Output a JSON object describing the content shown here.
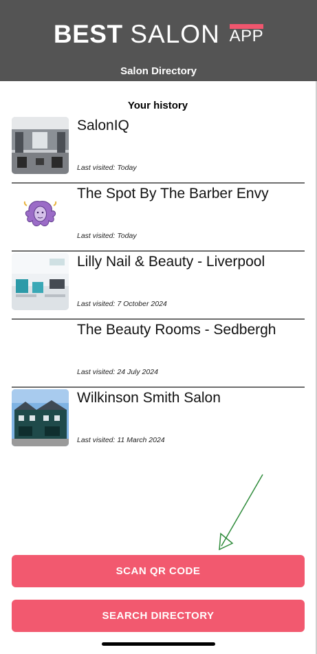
{
  "header": {
    "logo_best": "BEST",
    "logo_salon": "SALON",
    "logo_app": "APP",
    "subtitle": "Salon Directory"
  },
  "history": {
    "title": "Your history",
    "items": [
      {
        "name": "SalonIQ",
        "visited": "Last visited: Today",
        "thumb": "salon-interior-photo"
      },
      {
        "name": "The Spot By The Barber Envy",
        "visited": "Last visited: Today",
        "thumb": "medusa-logo"
      },
      {
        "name": "Lilly Nail & Beauty - Liverpool",
        "visited": "Last visited: 7 October 2024",
        "thumb": "nail-salon-photo"
      },
      {
        "name": "The Beauty Rooms - Sedbergh",
        "visited": "Last visited: 24 July 2024",
        "thumb": "none"
      },
      {
        "name": "Wilkinson Smith Salon",
        "visited": "Last visited: 11 March 2024",
        "thumb": "shopfront-photo"
      }
    ]
  },
  "buttons": {
    "scan": "SCAN QR CODE",
    "search": "SEARCH DIRECTORY"
  },
  "colors": {
    "header_bg": "#545454",
    "accent": "#f2596f",
    "annotation_arrow": "#2e8b3a"
  }
}
